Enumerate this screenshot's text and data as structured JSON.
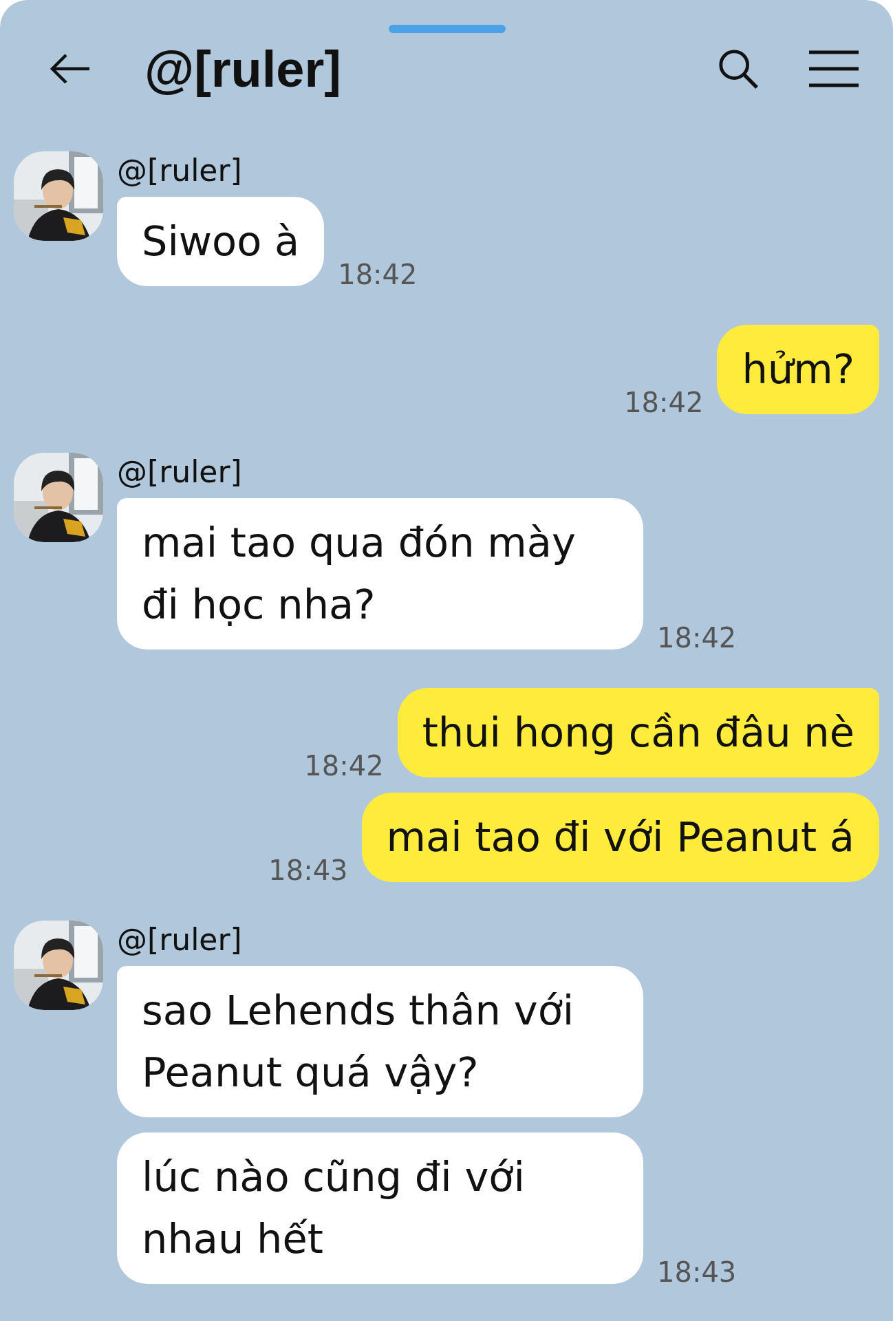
{
  "header": {
    "title": "@[ruler]"
  },
  "messages": [
    {
      "kind": "in",
      "sender": "@[ruler]",
      "bubbles": [
        {
          "text": "Siwoo à",
          "time": "18:42"
        }
      ]
    },
    {
      "kind": "out",
      "bubbles": [
        {
          "text": "hửm?",
          "time": "18:42"
        }
      ]
    },
    {
      "kind": "in",
      "sender": "@[ruler]",
      "bubbles": [
        {
          "text": "mai tao qua đón mày đi học nha?",
          "time": "18:42"
        }
      ]
    },
    {
      "kind": "out",
      "bubbles": [
        {
          "text": "thui hong cần đâu nè",
          "time": "18:42"
        },
        {
          "text": "mai tao đi với Peanut á",
          "time": "18:43"
        }
      ]
    },
    {
      "kind": "in",
      "sender": "@[ruler]",
      "bubbles": [
        {
          "text": "sao Lehends thân với Peanut quá vậy?"
        },
        {
          "text": "lúc nào cũng đi với nhau hết",
          "time": "18:43"
        }
      ]
    }
  ]
}
